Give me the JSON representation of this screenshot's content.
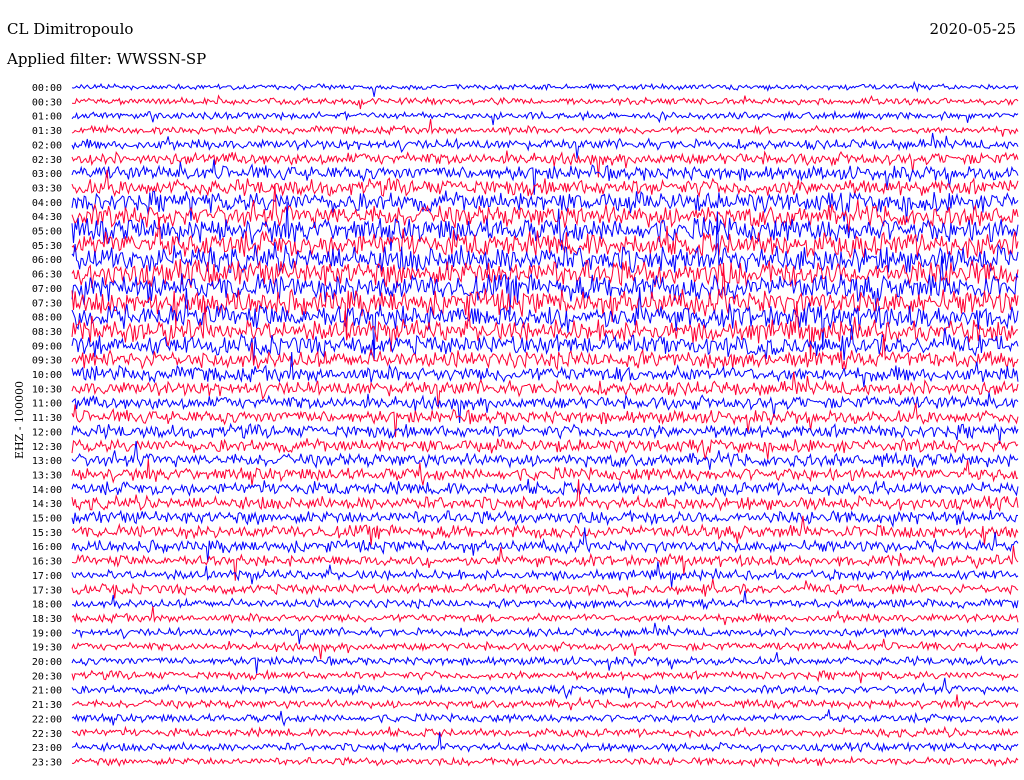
{
  "header": {
    "station": "CL Dimitropoulo",
    "filter": "Applied filter: WWSSN-SP",
    "date": "2020-05-25",
    "channel": "EHZ - 100000"
  },
  "colors": {
    "trace_a": "#0000ff",
    "trace_b": "#ff0033",
    "background": "#ffffff",
    "text": "#000000"
  },
  "chart_data": {
    "type": "line",
    "title": "",
    "xlabel": "",
    "ylabel": "EHZ - 100000",
    "grid": false,
    "row_labels": [
      "00:00",
      "00:30",
      "01:00",
      "01:30",
      "02:00",
      "02:30",
      "03:00",
      "03:30",
      "04:00",
      "04:30",
      "05:00",
      "05:30",
      "06:00",
      "06:30",
      "07:00",
      "07:30",
      "08:00",
      "08:30",
      "09:00",
      "09:30",
      "10:00",
      "10:30",
      "11:00",
      "11:30",
      "12:00",
      "12:30",
      "13:00",
      "13:30",
      "14:00",
      "14:30",
      "15:00",
      "15:30",
      "16:00",
      "16:30",
      "17:00",
      "17:30",
      "18:00",
      "18:30",
      "19:00",
      "19:30",
      "20:00",
      "20:30",
      "21:00",
      "21:30",
      "22:00",
      "22:30",
      "23:00",
      "23:30"
    ],
    "row_amplitude": [
      1.0,
      1.2,
      1.3,
      1.4,
      1.8,
      2.2,
      2.6,
      3.0,
      3.6,
      4.0,
      4.4,
      4.6,
      4.8,
      4.8,
      4.8,
      4.6,
      4.4,
      4.0,
      3.6,
      3.2,
      2.8,
      2.6,
      2.4,
      2.4,
      2.4,
      2.4,
      2.4,
      2.4,
      2.4,
      2.4,
      2.4,
      2.4,
      2.2,
      2.0,
      1.8,
      1.8,
      1.6,
      1.5,
      1.5,
      1.5,
      1.5,
      1.5,
      1.5,
      1.5,
      1.5,
      1.5,
      1.5,
      1.4
    ],
    "color_cycle": [
      "trace_a",
      "trace_b"
    ]
  }
}
